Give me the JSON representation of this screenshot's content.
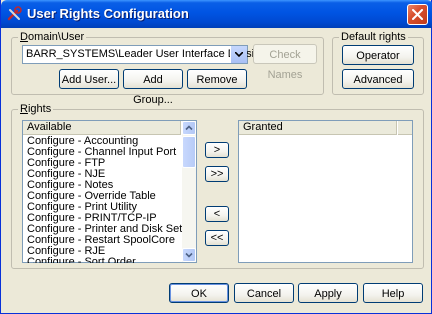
{
  "window": {
    "title": "User Rights Configuration"
  },
  "domain_user": {
    "group_label": "Domain\\User",
    "selected_value": "BARR_SYSTEMS\\Leader User Interface Division",
    "check_names_label": "Check Names",
    "add_user_label": "Add User...",
    "add_group_label": "Add Group...",
    "remove_label": "Remove"
  },
  "default_rights": {
    "group_label": "Default rights",
    "operator_label": "Operator",
    "advanced_label": "Advanced"
  },
  "rights": {
    "group_label": "Rights",
    "available_header": "Available",
    "granted_header": "Granted",
    "available_items": [
      "Configure - Accounting",
      "Configure - Channel Input Port",
      "Configure - FTP",
      "Configure - NJE",
      "Configure - Notes",
      "Configure - Override Table",
      "Configure - Print Utility",
      "Configure - PRINT/TCP-IP",
      "Configure - Printer and Disk Settings",
      "Configure - Restart SpoolCore",
      "Configure - RJE",
      "Configure - Sort Order"
    ],
    "granted_items": [],
    "add_label": ">",
    "add_all_label": ">>",
    "remove_label": "<",
    "remove_all_label": "<<"
  },
  "footer": {
    "ok_label": "OK",
    "cancel_label": "Cancel",
    "apply_label": "Apply",
    "help_label": "Help"
  },
  "icons": {
    "title": "tools-icon",
    "close": "close-icon",
    "dropdown": "chevron-down-icon",
    "scroll_up": "scroll-up-arrow-icon",
    "scroll_down": "scroll-down-arrow-icon"
  },
  "colors": {
    "titlebar": "#0054e3",
    "close_button": "#d8502f",
    "dialog_background": "#ece9d8",
    "button_border": "#003c74"
  }
}
